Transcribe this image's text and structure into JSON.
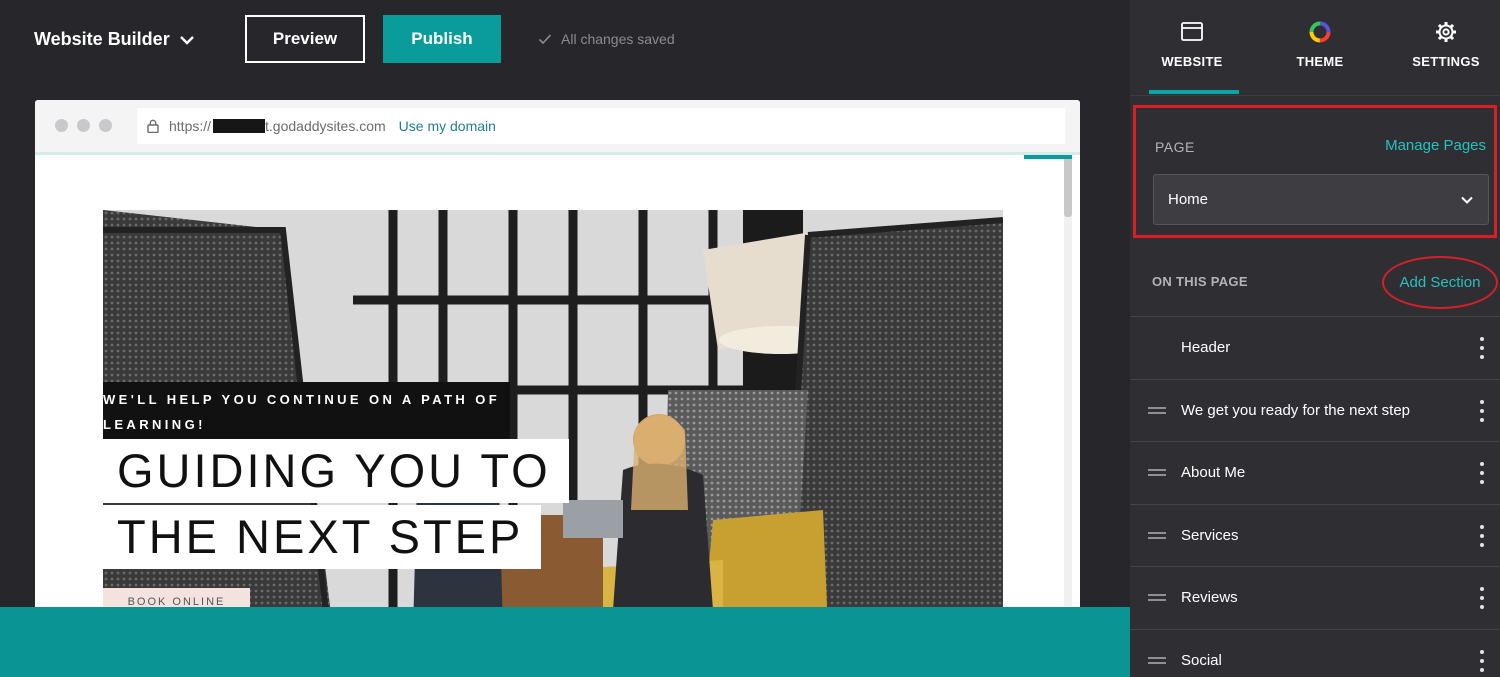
{
  "app": {
    "title": "Website Builder",
    "preview_label": "Preview",
    "publish_label": "Publish",
    "saved_status": "All changes saved"
  },
  "browser": {
    "url_prefix": "https://",
    "url_suffix": "t.godaddysites.com",
    "use_domain_label": "Use my domain"
  },
  "hero": {
    "eyebrow_line1": "WE'LL HELP YOU CONTINUE ON A PATH OF",
    "eyebrow_line2": "LEARNING!",
    "headline_line1": "GUIDING YOU TO",
    "headline_line2": "THE NEXT STEP",
    "button_label": "BOOK ONLINE"
  },
  "panel": {
    "tabs": [
      {
        "label": "WEBSITE",
        "icon": "browser-window-icon",
        "active": true
      },
      {
        "label": "THEME",
        "icon": "color-ring-icon",
        "active": false
      },
      {
        "label": "SETTINGS",
        "icon": "gear-icon",
        "active": false
      }
    ],
    "page_label": "PAGE",
    "manage_pages_label": "Manage Pages",
    "selected_page": "Home",
    "on_this_page_label": "ON THIS PAGE",
    "add_section_label": "Add Section",
    "sections": [
      {
        "label": "Header",
        "draggable": false
      },
      {
        "label": "We get you ready for the next step",
        "draggable": true
      },
      {
        "label": "About Me",
        "draggable": true
      },
      {
        "label": "Services",
        "draggable": true
      },
      {
        "label": "Reviews",
        "draggable": true
      },
      {
        "label": "Social",
        "draggable": true
      }
    ]
  },
  "colors": {
    "accent": "#0a9b9b",
    "link": "#25c1c1",
    "annotation": "#d91f26",
    "background": "#27272b",
    "panel": "#2f2f33"
  }
}
